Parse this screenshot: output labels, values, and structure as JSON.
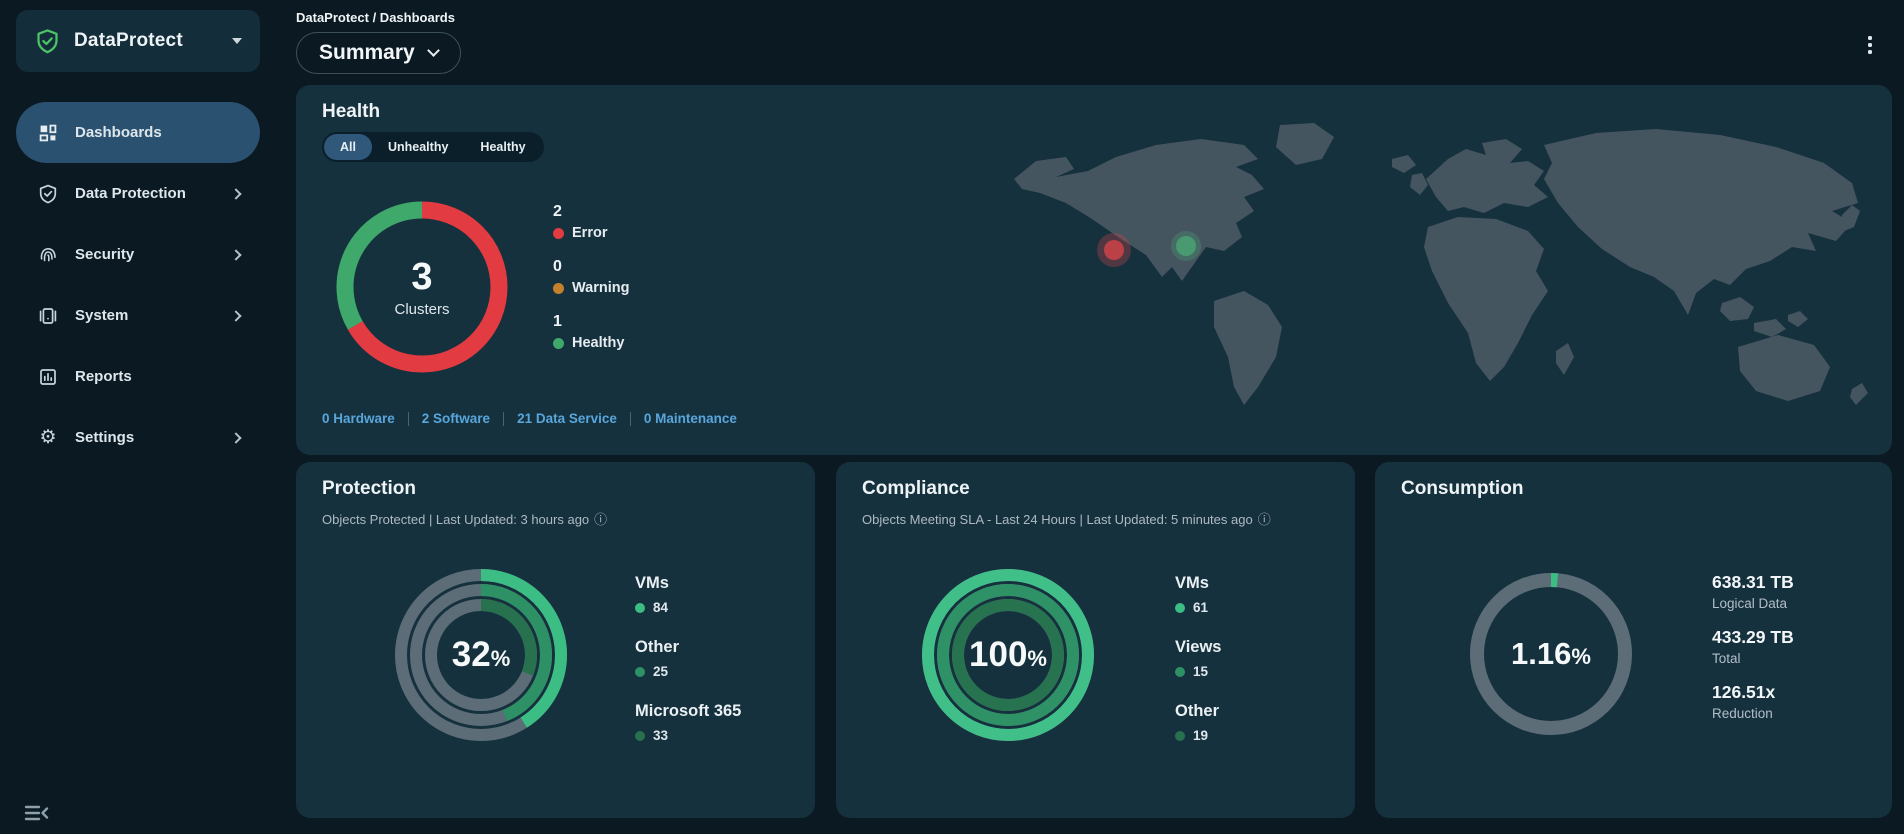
{
  "brand": {
    "name": "DataProtect"
  },
  "topbar": {
    "breadcrumb": "DataProtect / Dashboards",
    "view": "Summary"
  },
  "sidebar": {
    "items": [
      {
        "label": "Dashboards"
      },
      {
        "label": "Data Protection"
      },
      {
        "label": "Security"
      },
      {
        "label": "System"
      },
      {
        "label": "Reports"
      },
      {
        "label": "Settings"
      }
    ]
  },
  "health": {
    "title": "Health",
    "filters": [
      {
        "label": "All"
      },
      {
        "label": "Unhealthy"
      },
      {
        "label": "Healthy"
      }
    ],
    "selected_filter": "All",
    "donut": {
      "size": 186,
      "radius": 77,
      "stroke": 17,
      "gap": 0,
      "track": "none",
      "rings": [
        {
          "segments": [
            {
              "percent": 66.7,
              "color": "#e23b41"
            },
            {
              "percent": 33.3,
              "color": "#3fa96c"
            }
          ]
        }
      ],
      "center_value": "3",
      "center_label": "Clusters"
    },
    "legend": [
      {
        "value": "2",
        "label": "Error",
        "color": "#e23b41"
      },
      {
        "value": "0",
        "label": "Warning",
        "color": "#c5802b"
      },
      {
        "value": "1",
        "label": "Healthy",
        "color": "#3fa96c"
      }
    ],
    "links": [
      {
        "label": "0 Hardware"
      },
      {
        "label": "2 Software"
      },
      {
        "label": "21 Data Service"
      },
      {
        "label": "0 Maintenance"
      }
    ],
    "markers": [
      {
        "name": "error-cluster",
        "color": "#cf4348"
      },
      {
        "name": "healthy-cluster",
        "color": "#4aa173"
      }
    ],
    "map_land_color": "#45555f"
  },
  "protection": {
    "title": "Protection",
    "subtitle": "Objects Protected | Last Updated: 3 hours ago",
    "donut": {
      "size": 178,
      "radius": 80,
      "stroke": 12,
      "gap": 3,
      "track": "#5c6d78",
      "rings": [
        {
          "percent": 41,
          "color": "#3cbd84"
        },
        {
          "percent": 44,
          "color": "#2e9065"
        },
        {
          "percent": 31,
          "color": "#27714f"
        }
      ],
      "center_value": "32",
      "center_suffix": "%"
    },
    "legend": [
      {
        "label": "VMs",
        "value": "84",
        "color": "#3cbd84"
      },
      {
        "label": "Other",
        "value": "25",
        "color": "#2e9065"
      },
      {
        "label": "Microsoft 365",
        "value": "33",
        "color": "#27714f"
      }
    ]
  },
  "compliance": {
    "title": "Compliance",
    "subtitle": "Objects Meeting SLA - Last 24 Hours | Last Updated: 5 minutes ago",
    "donut": {
      "size": 178,
      "radius": 80,
      "stroke": 12,
      "gap": 3,
      "track": "#5c6d78",
      "rings": [
        {
          "percent": 100,
          "color": "#41bf88"
        },
        {
          "percent": 100,
          "color": "#2f9166"
        },
        {
          "percent": 100,
          "color": "#27734f"
        }
      ],
      "center_value": "100",
      "center_suffix": "%"
    },
    "legend": [
      {
        "label": "VMs",
        "value": "61",
        "color": "#3cbd84"
      },
      {
        "label": "Views",
        "value": "15",
        "color": "#2e9065"
      },
      {
        "label": "Other",
        "value": "19",
        "color": "#27714f"
      }
    ]
  },
  "consumption": {
    "title": "Consumption",
    "donut": {
      "size": 168,
      "radius": 74,
      "stroke": 14,
      "gap": 0,
      "track": "#5c6d78",
      "rings": [
        {
          "segments": [
            {
              "percent": 1.4,
              "color": "#3cbd84"
            }
          ]
        }
      ],
      "center_value": "1.16",
      "center_suffix": "%"
    },
    "stats": [
      {
        "value": "638.31 TB",
        "label": "Logical Data"
      },
      {
        "value": "433.29 TB",
        "label": "Total"
      },
      {
        "value": "126.51x",
        "label": "Reduction"
      }
    ]
  }
}
